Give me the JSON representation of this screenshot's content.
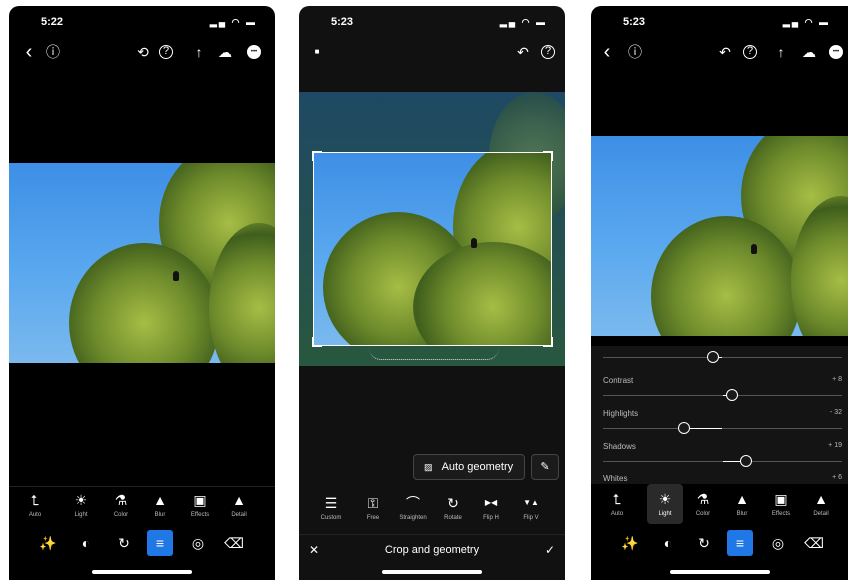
{
  "phone1": {
    "status": {
      "time": "5:22",
      "icons": "▂▄ ◠ ▬"
    },
    "top_icons": {
      "back": "‹",
      "info": "ⓘ",
      "history": "⟲",
      "help": "?",
      "share": "↑",
      "cloud": "☁",
      "more": "•••"
    },
    "tools": [
      {
        "icon": "⮤",
        "label": "Auto"
      },
      {
        "icon": "☀",
        "label": "Light"
      },
      {
        "icon": "⚗",
        "label": "Color"
      },
      {
        "icon": "▲",
        "label": "Blur"
      },
      {
        "icon": "▣",
        "label": "Effects"
      },
      {
        "icon": "▲",
        "label": "Detail"
      }
    ],
    "nav": [
      "✨",
      "◐",
      "↻",
      "≡",
      "◎",
      "⌫"
    ]
  },
  "phone2": {
    "status": {
      "time": "5:23",
      "icons": "▂▄ ◠ ▬"
    },
    "top_icons": {
      "aspect": "■",
      "undo": "↶",
      "help": "?"
    },
    "auto_geometry": "Auto geometry",
    "tools": [
      {
        "icon": "☰",
        "label": "Custom"
      },
      {
        "icon": "⚿",
        "label": "Free"
      },
      {
        "icon": "⌒",
        "label": "Straighten"
      },
      {
        "icon": "↻",
        "label": "Rotate"
      },
      {
        "icon": "▶◀",
        "label": "Flip H"
      },
      {
        "icon": "▼▲",
        "label": "Flip V"
      }
    ],
    "bottom_title": "Crop and geometry",
    "cancel": "✕",
    "confirm": "✓"
  },
  "phone3": {
    "status": {
      "time": "5:23",
      "icons": "▂▄ ◠ ▬"
    },
    "top_icons": {
      "back": "‹",
      "info": "ⓘ",
      "undo": "↶",
      "help": "?",
      "share": "↑",
      "cloud": "☁",
      "more": "•••"
    },
    "sliders": [
      {
        "name": "",
        "value": "",
        "position": 0.46,
        "fill_from": 0.5
      },
      {
        "name": "Contrast",
        "value": "+ 8",
        "position": 0.54,
        "fill_from": 0.5
      },
      {
        "name": "Highlights",
        "value": "- 32",
        "position": 0.34,
        "fill_from": 0.5
      },
      {
        "name": "Shadows",
        "value": "+ 19",
        "position": 0.6,
        "fill_from": 0.5
      },
      {
        "name": "Whites",
        "value": "+ 6",
        "position": 0.52,
        "fill_from": 0.5
      }
    ],
    "tools": [
      {
        "icon": "⮤",
        "label": "Auto"
      },
      {
        "icon": "☀",
        "label": "Light"
      },
      {
        "icon": "⚗",
        "label": "Color"
      },
      {
        "icon": "▲",
        "label": "Blur"
      },
      {
        "icon": "▣",
        "label": "Effects"
      },
      {
        "icon": "▲",
        "label": "Detail"
      }
    ],
    "nav": [
      "✨",
      "◐",
      "↻",
      "≡",
      "◎",
      "⌫"
    ]
  }
}
